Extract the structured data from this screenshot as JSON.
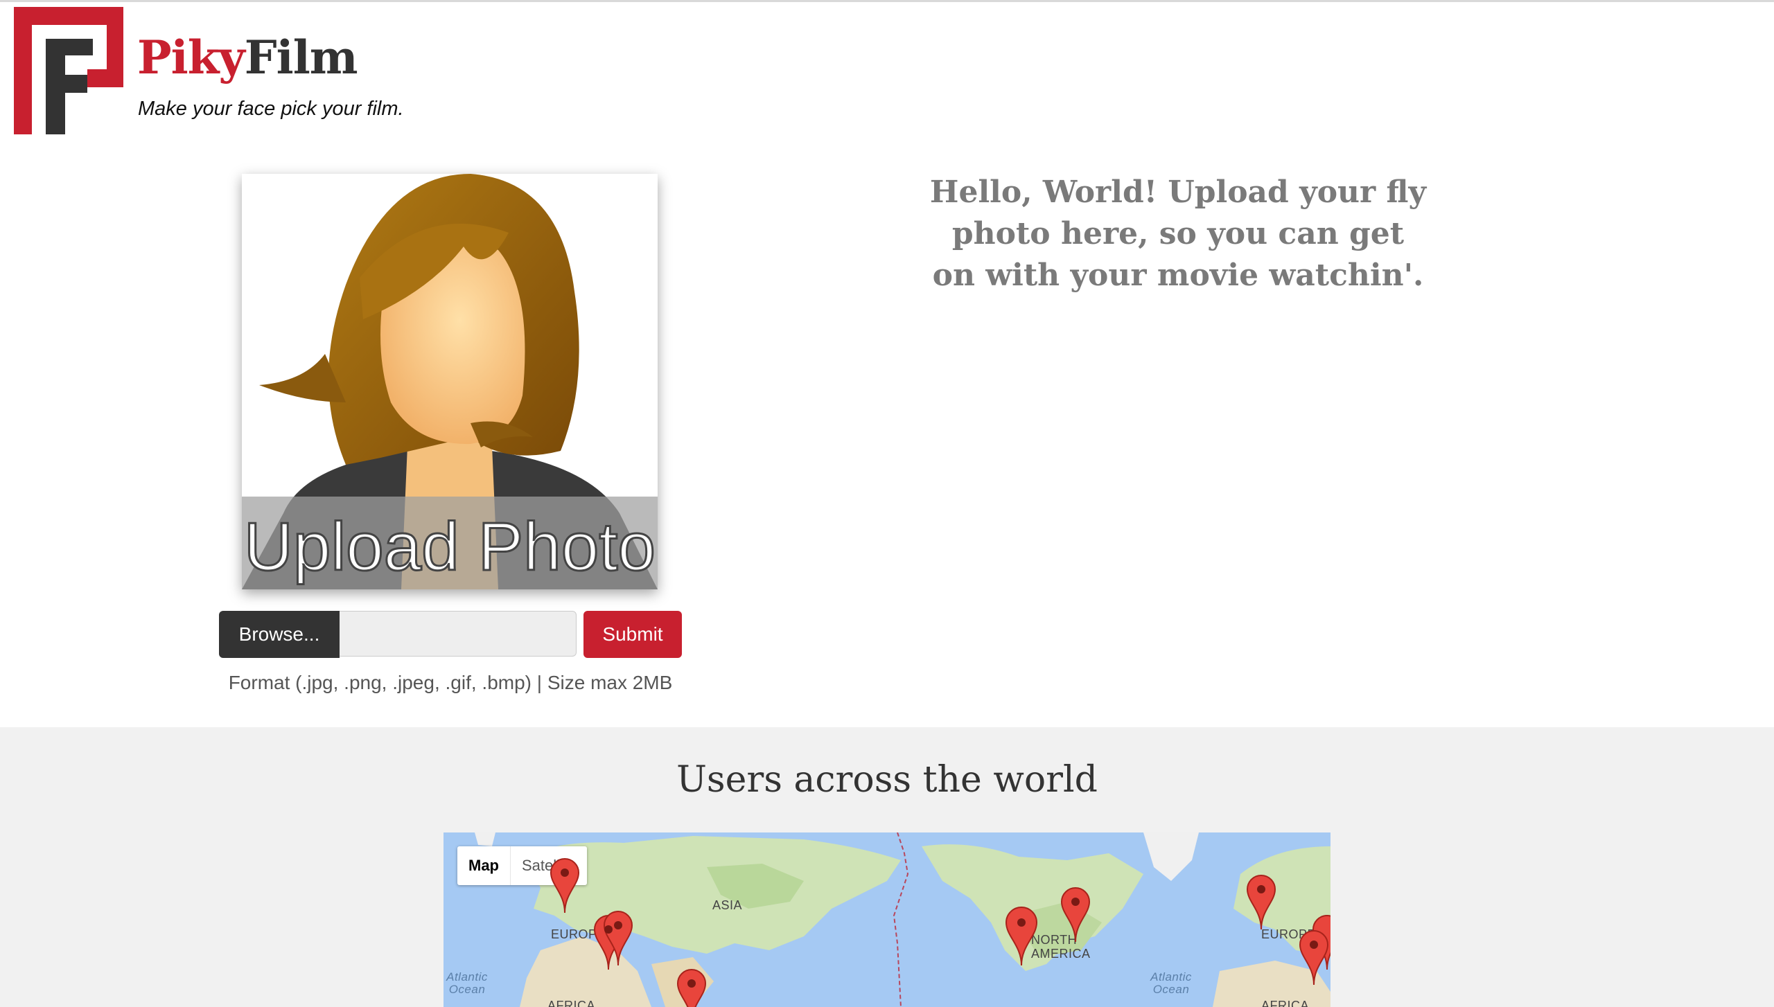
{
  "header": {
    "brand_part1": "Piky",
    "brand_part2": "Film",
    "tagline": "Make your face pick your film."
  },
  "upload": {
    "photo_overlay_text": "Upload Photo",
    "browse_label": "Browse...",
    "file_value": "",
    "submit_label": "Submit",
    "format_note": "Format (.jpg, .png, .jpeg, .gif, .bmp) | Size max 2MB"
  },
  "intro": {
    "message": "Hello, World! Upload your fly photo here, so you can get on with your movie watchin'."
  },
  "users_map": {
    "title": "Users across the world",
    "map_type_options": [
      "Map",
      "Satellite"
    ],
    "selected_map_type": "Map",
    "labels": {
      "asia": "ASIA",
      "europe_left": "EUROPE",
      "north_america": "NORTH AMERICA",
      "europe_right": "EUROPE",
      "atlantic_left": "Atlantic Ocean",
      "atlantic_right": "Atlantic Ocean",
      "africa_left": "AFRICA",
      "africa_right": "AFRICA"
    },
    "marker_color": "#e8453c"
  },
  "colors": {
    "brand_red": "#c8202f",
    "brand_dark": "#333333",
    "intro_gray": "#7a7a7a",
    "water": "#a5c9f3"
  }
}
